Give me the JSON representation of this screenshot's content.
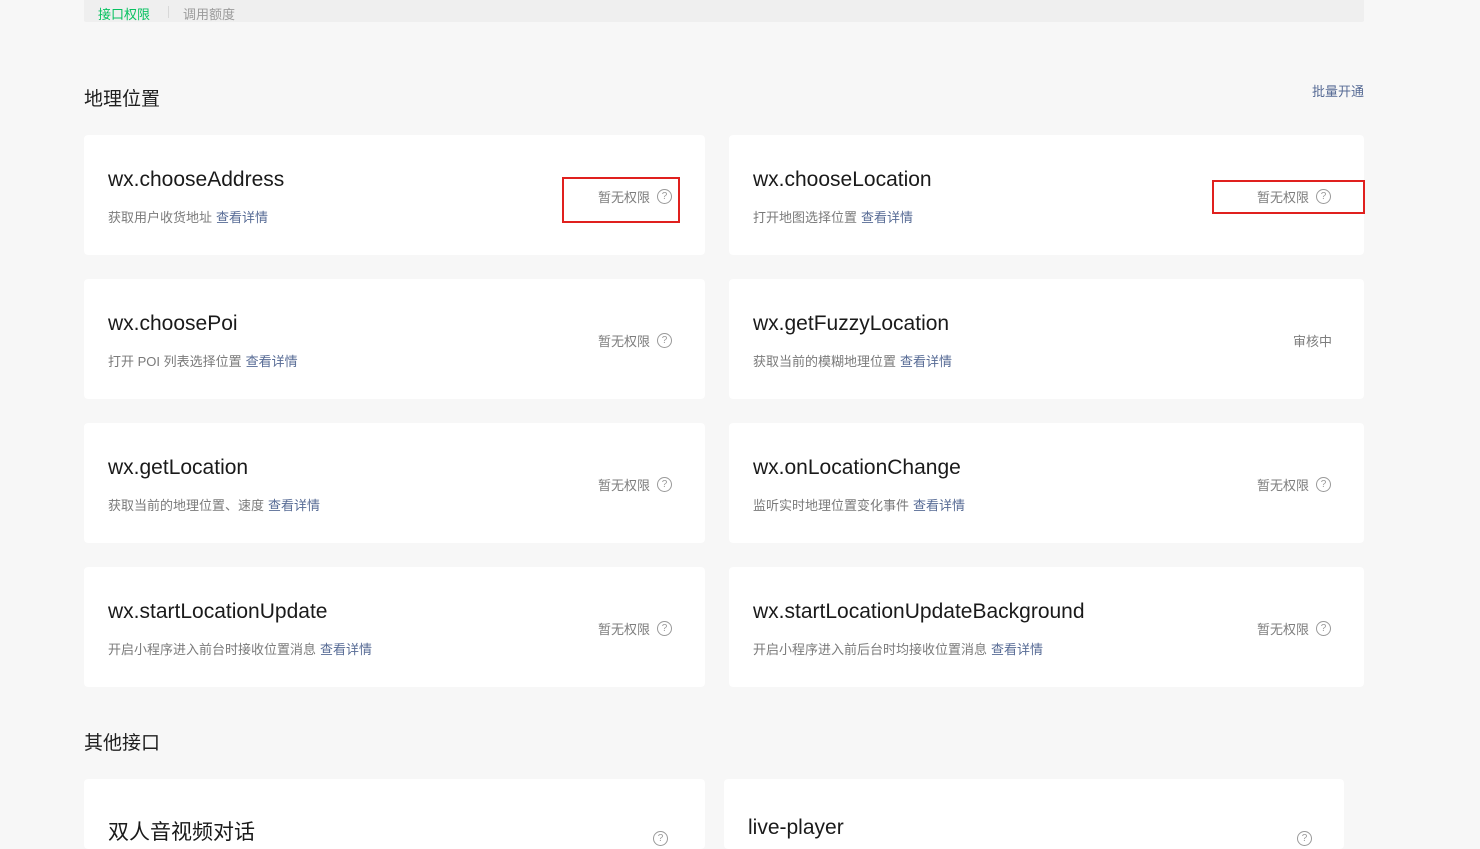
{
  "tabs": [
    {
      "label": "接口权限",
      "active": true
    },
    {
      "label": "调用额度",
      "active": false
    }
  ],
  "sections": {
    "location": {
      "title": "地理位置",
      "batch_label": "批量开通"
    },
    "other": {
      "title": "其他接口"
    }
  },
  "detail_link_label": "查看详情",
  "cards": [
    {
      "name": "wx.chooseAddress",
      "desc": "获取用户收货地址",
      "status": "暂无权限"
    },
    {
      "name": "wx.chooseLocation",
      "desc": "打开地图选择位置",
      "status": "暂无权限"
    },
    {
      "name": "wx.choosePoi",
      "desc": "打开 POI 列表选择位置",
      "status": "暂无权限"
    },
    {
      "name": "wx.getFuzzyLocation",
      "desc": "获取当前的模糊地理位置",
      "status": "审核中"
    },
    {
      "name": "wx.getLocation",
      "desc": "获取当前的地理位置、速度",
      "status": "暂无权限"
    },
    {
      "name": "wx.onLocationChange",
      "desc": "监听实时地理位置变化事件",
      "status": "暂无权限"
    },
    {
      "name": "wx.startLocationUpdate",
      "desc": "开启小程序进入前台时接收位置消息",
      "status": "暂无权限"
    },
    {
      "name": "wx.startLocationUpdateBackground",
      "desc": "开启小程序进入前后台时均接收位置消息",
      "status": "暂无权限"
    }
  ],
  "other_cards": [
    {
      "name": "双人音视频对话"
    },
    {
      "name": "live-player"
    }
  ],
  "help_glyph": "?",
  "colors": {
    "accent_green": "#07c160",
    "link_blue": "#576b95",
    "highlight_red": "#e0201e",
    "page_bg": "#f7f7f7"
  }
}
